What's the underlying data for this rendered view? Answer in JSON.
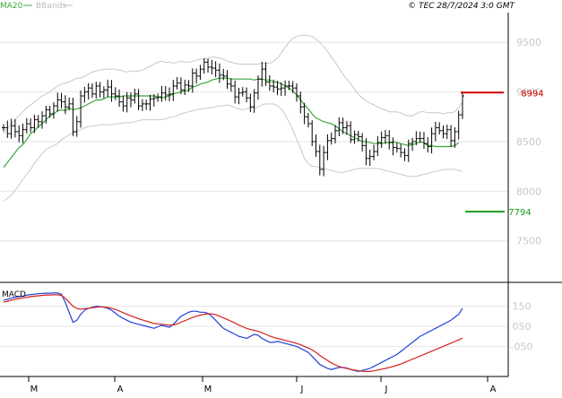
{
  "legend": {
    "ma_label": "MA20",
    "bb_label": "BBands"
  },
  "copyright": "© TEC 28/7/2024 3:0 GMT",
  "macd_title": "MACD",
  "colors": {
    "ma": "#3aa83a",
    "bb": "#c8c8c8",
    "price": "#000000",
    "resistance": "#d40000",
    "support": "#1c9a1c",
    "macd": "#1f3fd6",
    "signal": "#d42020",
    "grid": "#e6e6e6",
    "axis_text": "#c8c8c8"
  },
  "chart_data": [
    {
      "type": "ohlc",
      "title": "",
      "y_axis_ticks": [
        "9500",
        "9000",
        "8500",
        "8000",
        "7500"
      ],
      "ylim": [
        7100,
        9800
      ],
      "x_axis_ticks": [
        "M",
        "A",
        "M",
        "J",
        "J",
        "A"
      ],
      "levels": [
        {
          "name": "resistance",
          "value": 8994,
          "label": "8994"
        },
        {
          "name": "support",
          "value": 7794,
          "label": "7794"
        }
      ],
      "series": {
        "close": [
          8640,
          8580,
          8660,
          8600,
          8560,
          8620,
          8680,
          8640,
          8720,
          8700,
          8760,
          8820,
          8780,
          8860,
          8920,
          8900,
          8850,
          8880,
          8600,
          8700,
          8960,
          9000,
          9040,
          8980,
          9060,
          9000,
          9020,
          9050,
          8980,
          8960,
          8900,
          8860,
          8940,
          8920,
          8980,
          8860,
          8880,
          8880,
          8930,
          8940,
          8950,
          8990,
          8970,
          8980,
          9060,
          9090,
          9020,
          9070,
          9060,
          9190,
          9160,
          9230,
          9300,
          9250,
          9240,
          9220,
          9170,
          9160,
          9080,
          9060,
          8950,
          8990,
          9000,
          8940,
          8850,
          8990,
          9130,
          9230,
          9100,
          9060,
          9050,
          9030,
          9040,
          9060,
          9060,
          9040,
          8960,
          8850,
          8750,
          8680,
          8500,
          8400,
          8220,
          8390,
          8510,
          8530,
          8610,
          8690,
          8640,
          8660,
          8520,
          8570,
          8550,
          8460,
          8330,
          8350,
          8400,
          8490,
          8540,
          8560,
          8490,
          8440,
          8430,
          8390,
          8360,
          8480,
          8500,
          8530,
          8530,
          8480,
          8450,
          8580,
          8640,
          8610,
          8580,
          8620,
          8510,
          8600,
          8770,
          8960
        ],
        "ma20": [
          8240,
          8290,
          8340,
          8390,
          8440,
          8470,
          8520,
          8580,
          8610,
          8650,
          8680,
          8720,
          8760,
          8780,
          8810,
          8820,
          8810,
          8840,
          8820,
          8830,
          8840,
          8860,
          8880,
          8900,
          8920,
          8920,
          8930,
          8950,
          8950,
          8950,
          8950,
          8960,
          8960,
          8960,
          8960,
          8960,
          8960,
          8960,
          8960,
          8960,
          8950,
          8940,
          8950,
          8960,
          8980,
          8990,
          9000,
          9010,
          9020,
          9050,
          9060,
          9080,
          9090,
          9100,
          9120,
          9130,
          9140,
          9140,
          9140,
          9130,
          9130,
          9130,
          9130,
          9130,
          9130,
          9120,
          9130,
          9130,
          9120,
          9120,
          9100,
          9100,
          9080,
          9060,
          9040,
          9010,
          8970,
          8920,
          8870,
          8830,
          8780,
          8740,
          8720,
          8700,
          8690,
          8680,
          8660,
          8630,
          8600,
          8580,
          8560,
          8540,
          8520,
          8500,
          8500,
          8490,
          8480,
          8480,
          8480,
          8490,
          8490,
          8500,
          8490,
          8480,
          8470,
          8460,
          8470,
          8480,
          8500,
          8490,
          8460,
          8460,
          8450,
          8450,
          8450,
          8450,
          8450,
          8460,
          8490
        ],
        "bb_upper": [
          8580,
          8630,
          8680,
          8720,
          8760,
          8800,
          8840,
          8870,
          8900,
          8930,
          8960,
          8980,
          9000,
          9030,
          9060,
          9080,
          9090,
          9100,
          9120,
          9140,
          9140,
          9160,
          9180,
          9200,
          9210,
          9220,
          9230,
          9230,
          9230,
          9230,
          9220,
          9210,
          9200,
          9210,
          9210,
          9210,
          9220,
          9240,
          9260,
          9280,
          9300,
          9310,
          9300,
          9300,
          9290,
          9300,
          9310,
          9300,
          9300,
          9310,
          9320,
          9330,
          9330,
          9340,
          9350,
          9350,
          9340,
          9330,
          9310,
          9300,
          9290,
          9280,
          9280,
          9280,
          9280,
          9280,
          9280,
          9290,
          9290,
          9290,
          9310,
          9340,
          9390,
          9450,
          9500,
          9540,
          9560,
          9570,
          9570,
          9570,
          9560,
          9530,
          9500,
          9460,
          9410,
          9350,
          9300,
          9240,
          9180,
          9130,
          9080,
          9030,
          8980,
          8940,
          8910,
          8890,
          8870,
          8850,
          8830,
          8820,
          8800,
          8800,
          8800,
          8790,
          8770,
          8760,
          8760,
          8780,
          8800,
          8800,
          8790,
          8790,
          8790,
          8790,
          8780,
          8790,
          8790,
          8800,
          8840,
          8900
        ],
        "bb_lower": [
          7900,
          7930,
          7960,
          8010,
          8060,
          8120,
          8170,
          8220,
          8280,
          8330,
          8380,
          8420,
          8440,
          8460,
          8480,
          8520,
          8540,
          8570,
          8590,
          8600,
          8620,
          8640,
          8650,
          8660,
          8660,
          8670,
          8670,
          8670,
          8670,
          8680,
          8680,
          8690,
          8690,
          8690,
          8700,
          8710,
          8720,
          8720,
          8720,
          8720,
          8720,
          8720,
          8730,
          8740,
          8750,
          8760,
          8780,
          8790,
          8800,
          8810,
          8820,
          8830,
          8830,
          8840,
          8840,
          8850,
          8860,
          8860,
          8870,
          8860,
          8840,
          8830,
          8820,
          8830,
          8840,
          8840,
          8850,
          8870,
          8880,
          8880,
          8880,
          8860,
          8830,
          8770,
          8700,
          8620,
          8520,
          8430,
          8330,
          8280,
          8250,
          8250,
          8240,
          8230,
          8220,
          8210,
          8200,
          8190,
          8190,
          8200,
          8210,
          8220,
          8230,
          8230,
          8230,
          8230,
          8230,
          8230,
          8220,
          8210,
          8200,
          8190,
          8180,
          8170,
          8160,
          8150,
          8150,
          8150,
          8160,
          8170,
          8180,
          8190,
          8200,
          8210,
          8220,
          8220,
          8220,
          8220,
          8210,
          8200
        ]
      }
    },
    {
      "type": "line",
      "title": "MACD",
      "y_axis_ticks": [
        "150",
        "050",
        "-050"
      ],
      "ylim": [
        -200,
        260
      ],
      "series": [
        {
          "name": "macd",
          "values": [
            180,
            185,
            190,
            195,
            198,
            200,
            205,
            208,
            210,
            212,
            214,
            215,
            215,
            216,
            216,
            210,
            170,
            120,
            70,
            80,
            110,
            130,
            140,
            145,
            150,
            148,
            145,
            140,
            130,
            115,
            100,
            90,
            80,
            70,
            65,
            60,
            55,
            50,
            45,
            40,
            48,
            55,
            50,
            45,
            60,
            80,
            100,
            110,
            120,
            125,
            125,
            120,
            120,
            115,
            100,
            80,
            60,
            40,
            30,
            20,
            10,
            0,
            -5,
            -10,
            0,
            10,
            5,
            -10,
            -20,
            -30,
            -30,
            -25,
            -30,
            -35,
            -40,
            -45,
            -50,
            -60,
            -70,
            -80,
            -100,
            -120,
            -140,
            -150,
            -160,
            -165,
            -160,
            -155,
            -155,
            -158,
            -165,
            -170,
            -175,
            -170,
            -165,
            -160,
            -150,
            -140,
            -130,
            -120,
            -110,
            -100,
            -90,
            -75,
            -60,
            -45,
            -30,
            -15,
            0,
            10,
            20,
            30,
            40,
            50,
            60,
            70,
            80,
            95,
            110,
            140
          ]
        },
        {
          "name": "signal",
          "values": [
            170,
            175,
            180,
            185,
            188,
            192,
            195,
            198,
            200,
            202,
            204,
            206,
            206,
            207,
            207,
            204,
            190,
            170,
            150,
            140,
            135,
            138,
            140,
            142,
            145,
            147,
            146,
            144,
            140,
            134,
            126,
            118,
            110,
            102,
            95,
            88,
            82,
            76,
            70,
            64,
            62,
            60,
            58,
            56,
            57,
            62,
            70,
            78,
            86,
            94,
            100,
            106,
            110,
            112,
            112,
            108,
            100,
            92,
            84,
            75,
            66,
            56,
            48,
            40,
            34,
            30,
            25,
            18,
            10,
            2,
            -5,
            -10,
            -15,
            -20,
            -25,
            -30,
            -35,
            -42,
            -50,
            -58,
            -68,
            -80,
            -95,
            -108,
            -120,
            -132,
            -142,
            -150,
            -156,
            -160,
            -164,
            -168,
            -172,
            -174,
            -175,
            -175,
            -172,
            -168,
            -164,
            -160,
            -155,
            -150,
            -144,
            -138,
            -130,
            -122,
            -114,
            -106,
            -98,
            -90,
            -82,
            -74,
            -66,
            -58,
            -50,
            -42,
            -34,
            -26,
            -18,
            -8
          ]
        }
      ]
    }
  ]
}
